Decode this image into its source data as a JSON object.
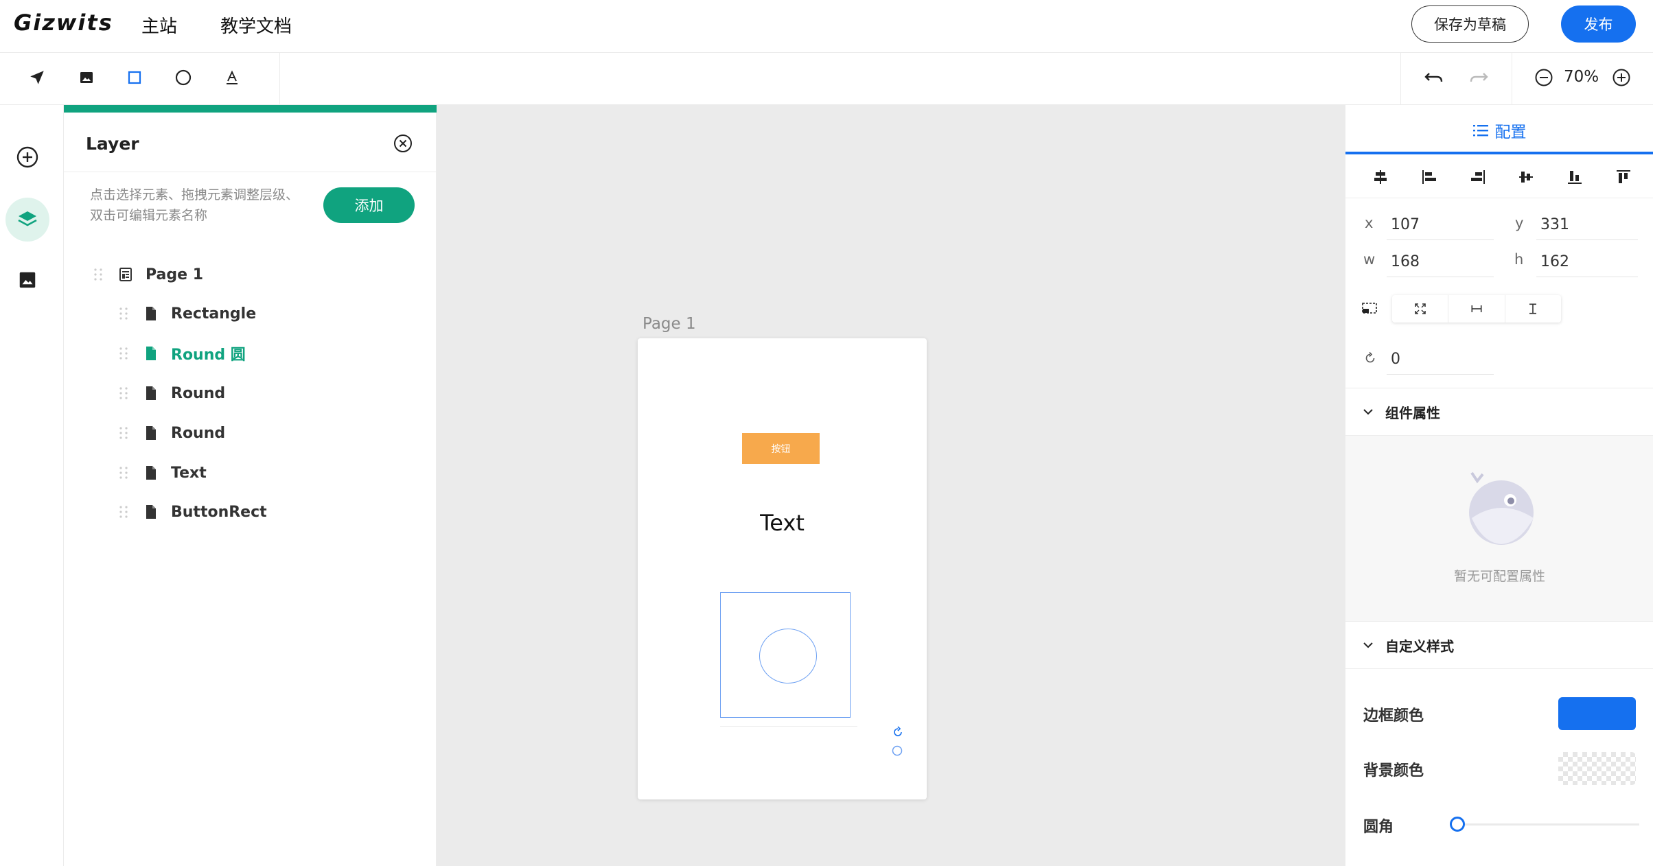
{
  "header": {
    "logo": "Gizwits",
    "nav": [
      "主站",
      "教学文档"
    ],
    "save_draft": "保存为草稿",
    "publish": "发布"
  },
  "toolbar": {
    "tools": [
      "navigate-icon",
      "image-icon",
      "rectangle-icon",
      "circle-icon",
      "text-icon"
    ],
    "active_tool": "rectangle-icon",
    "zoom": "70%"
  },
  "rail": {
    "items": [
      "add-icon",
      "layers-icon",
      "image-icon"
    ],
    "active": "layers-icon"
  },
  "layer_panel": {
    "title": "Layer",
    "hint": "点击选择元素、拖拽元素调整层级、双击可编辑元素名称",
    "add_label": "添加",
    "tree": [
      {
        "label": "Page 1",
        "level": 0
      },
      {
        "label": "Rectangle",
        "level": 1
      },
      {
        "label": "Round 圆",
        "level": 1,
        "active": true
      },
      {
        "label": "Round",
        "level": 1
      },
      {
        "label": "Round",
        "level": 1
      },
      {
        "label": "Text",
        "level": 1
      },
      {
        "label": "ButtonRect",
        "level": 1
      }
    ]
  },
  "canvas": {
    "page_label": "Page 1",
    "button_text": "按钮",
    "text_element": "Text"
  },
  "config": {
    "tab_label": "配置",
    "fields": {
      "x_label": "x",
      "x": "107",
      "y_label": "y",
      "y": "331",
      "w_label": "w",
      "w": "168",
      "h_label": "h",
      "h": "162",
      "rotation": "0"
    },
    "component_props_title": "组件属性",
    "empty_text": "暂无可配置属性",
    "custom_style_title": "自定义样式",
    "border_color_label": "边框颜色",
    "border_color": "#1570ef",
    "bg_color_label": "背景颜色",
    "radius_label": "圆角",
    "radius_value": 0
  },
  "colors": {
    "accent_green": "#10a37f",
    "accent_blue": "#1570ef",
    "button_orange": "#f7a94c"
  }
}
